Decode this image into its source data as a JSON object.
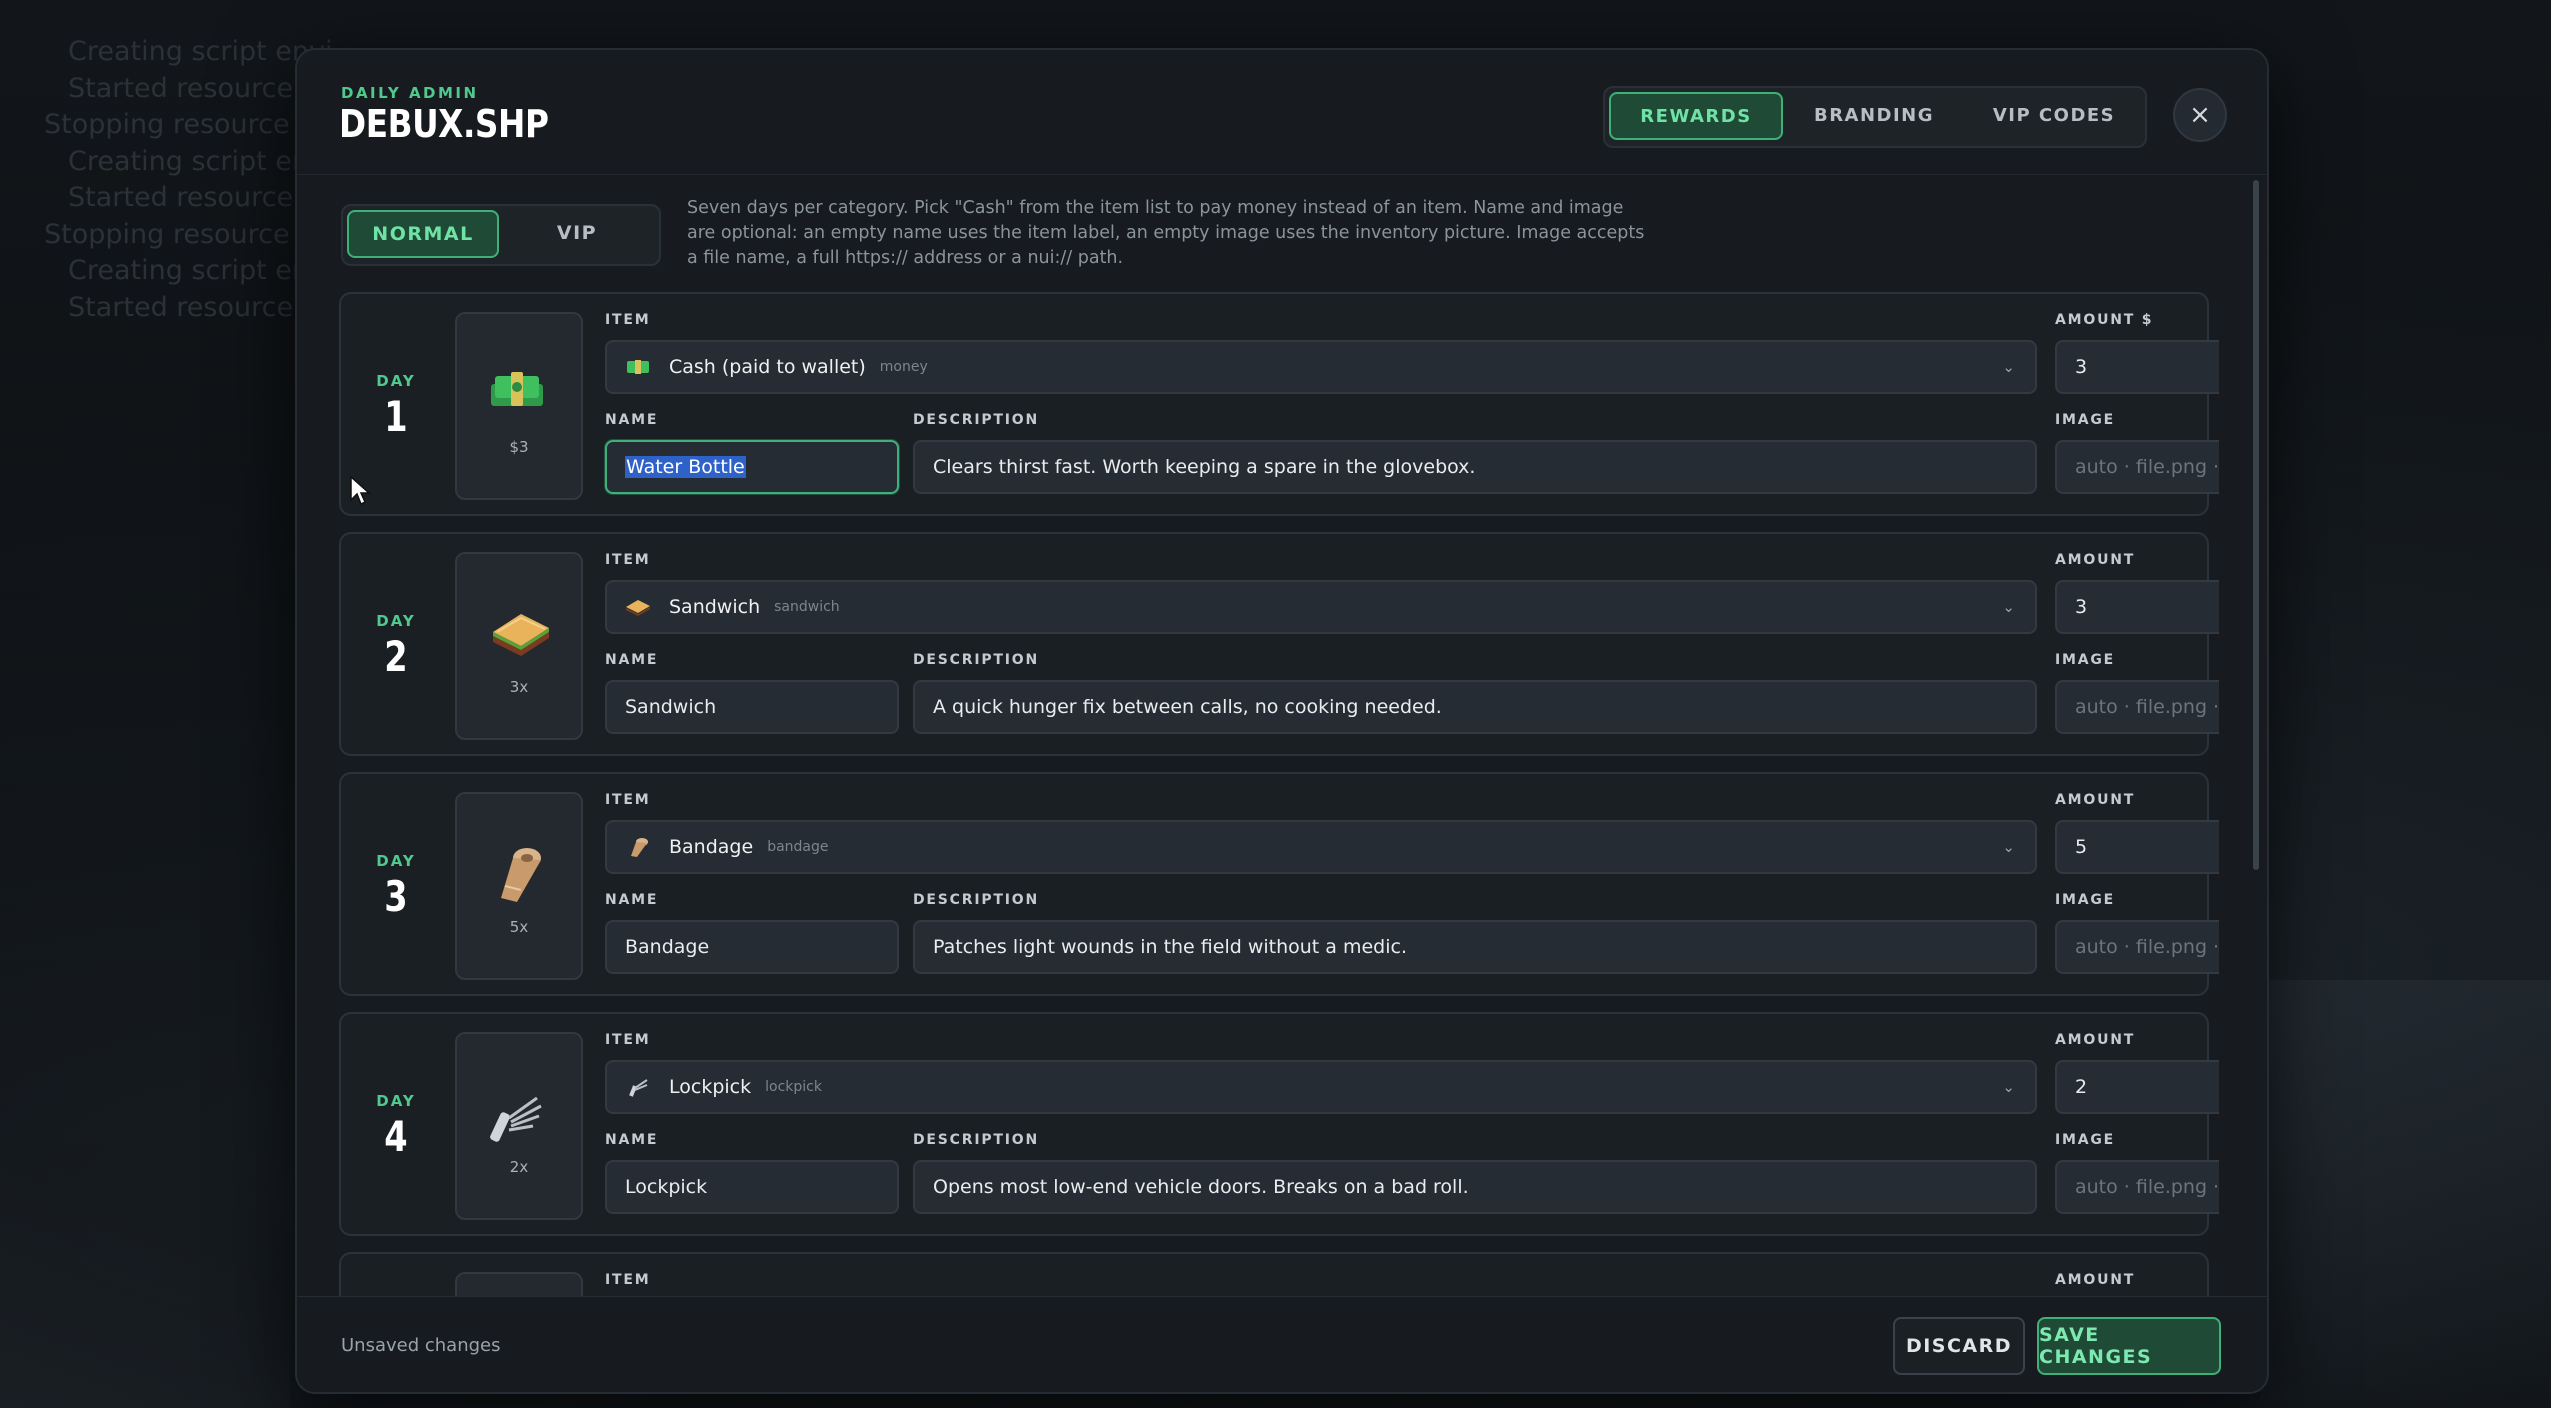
{
  "background": {
    "console_lines": [
      {
        "text": "Creating script envi",
        "indent": 1
      },
      {
        "text": "Started resource ba",
        "indent": 1
      },
      {
        "text": "Stopping resource ba",
        "indent": 0
      },
      {
        "text": "Creating script envi",
        "indent": 1
      },
      {
        "text": "Started resource ba",
        "indent": 1
      },
      {
        "text": "Stopping resource ba",
        "indent": 0
      },
      {
        "text": "Creating script envi",
        "indent": 1
      },
      {
        "text": "Started resource ba",
        "indent": 1
      }
    ]
  },
  "header": {
    "subtitle": "DAILY ADMIN",
    "title": "DEBUX.SHP",
    "tabs": [
      {
        "label": "REWARDS",
        "active": true
      },
      {
        "label": "BRANDING",
        "active": false
      },
      {
        "label": "VIP CODES",
        "active": false
      }
    ],
    "close_symbol": "×"
  },
  "toolbar": {
    "segments": [
      {
        "label": "NORMAL",
        "active": true
      },
      {
        "label": "VIP",
        "active": false
      }
    ],
    "help_text": "Seven days per category. Pick \"Cash\" from the item list to pay money instead of an item. Name and image are optional: an empty name uses the item label, an empty image uses the inventory picture. Image accepts a file name, a full https:// address or a nui:// path."
  },
  "labels": {
    "day": "DAY",
    "item": "ITEM",
    "name": "NAME",
    "description": "DESCRIPTION",
    "image": "IMAGE",
    "chevron": "⌄"
  },
  "rewards": [
    {
      "day": "1",
      "preview_icon": "cash-icon",
      "preview_qty": "$3",
      "item_label": "Cash (paid to wallet)",
      "item_key": "money",
      "amount_label": "AMOUNT $",
      "amount": "3",
      "name": "Water Bottle",
      "description": "Clears thirst fast. Worth keeping a spare in the glovebox.",
      "image_placeholder": "auto · file.png · http"
    },
    {
      "day": "2",
      "preview_icon": "sandwich-icon",
      "preview_qty": "3x",
      "item_label": "Sandwich",
      "item_key": "sandwich",
      "amount_label": "AMOUNT",
      "amount": "3",
      "name": "Sandwich",
      "description": "A quick hunger fix between calls, no cooking needed.",
      "image_placeholder": "auto · file.png · http"
    },
    {
      "day": "3",
      "preview_icon": "bandage-icon",
      "preview_qty": "5x",
      "item_label": "Bandage",
      "item_key": "bandage",
      "amount_label": "AMOUNT",
      "amount": "5",
      "name": "Bandage",
      "description": "Patches light wounds in the field without a medic.",
      "image_placeholder": "auto · file.png · http"
    },
    {
      "day": "4",
      "preview_icon": "lockpick-icon",
      "preview_qty": "2x",
      "item_label": "Lockpick",
      "item_key": "lockpick",
      "amount_label": "AMOUNT",
      "amount": "2",
      "name": "Lockpick",
      "description": "Opens most low-end vehicle doors. Breaks on a bad roll.",
      "image_placeholder": "auto · file.png · http"
    }
  ],
  "partial_card": {
    "item_label": "ITEM",
    "amount_label": "AMOUNT"
  },
  "footer": {
    "status": "Unsaved changes",
    "discard_label": "DISCARD",
    "save_label": "SAVE CHANGES"
  },
  "colors": {
    "accent": "#3fb07a",
    "accent_text": "#6fe3a6",
    "day_label": "#4fc98c",
    "selection": "#2f62c9"
  }
}
